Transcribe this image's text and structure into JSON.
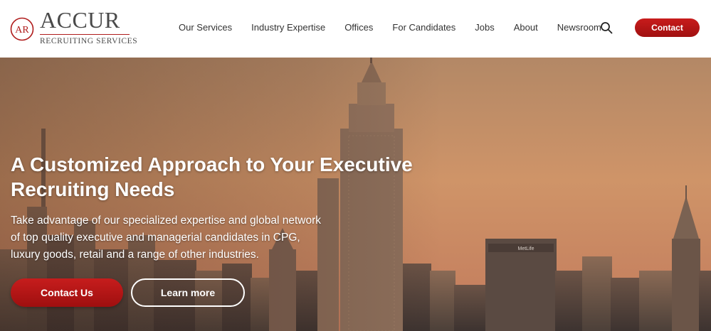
{
  "brand": {
    "logo_word": "ACCUR",
    "logo_sub": "RECRUITING SERVICES",
    "logo_monogram": "AR",
    "accent_color": "#b01c1c"
  },
  "nav": {
    "items": [
      {
        "label": "Our Services"
      },
      {
        "label": "Industry Expertise"
      },
      {
        "label": "Offices"
      },
      {
        "label": "For Candidates"
      },
      {
        "label": "Jobs"
      },
      {
        "label": "About"
      },
      {
        "label": "Newsroom"
      }
    ],
    "search_icon": "search-icon",
    "contact_label": "Contact"
  },
  "hero": {
    "headline_line1": "A Customized Approach to Your Executive",
    "headline_line2": "Recruiting Needs",
    "subtext_line1": "Take advantage of our specialized expertise and global network",
    "subtext_line2": "of top quality executive and managerial candidates in CPG,",
    "subtext_line3": "luxury goods, retail and a range of other industries.",
    "primary_button": "Contact Us",
    "secondary_button": "Learn more",
    "building_sign": "MetLife"
  }
}
